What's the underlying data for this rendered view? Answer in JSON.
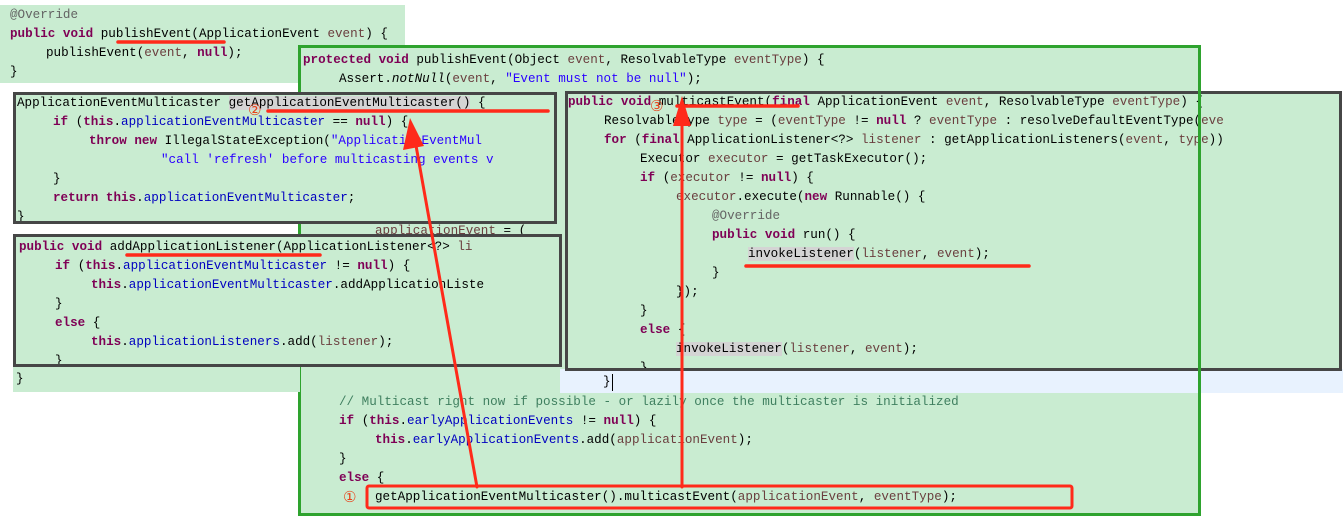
{
  "colors": {
    "panel_bg": "#c9ecd1",
    "keyword": "#7f0055",
    "field": "#0000c0",
    "string": "#2a00ff",
    "comment": "#3f7f5f",
    "annotation_mark": "#ff2a1a",
    "green_frame": "#2ea32e",
    "dark_frame": "#464646"
  },
  "panelA": {
    "lines": [
      [
        [
          "a",
          "@Override"
        ]
      ],
      [
        [
          "k",
          "public void "
        ],
        [
          "p",
          "publishEvent(ApplicationEvent "
        ],
        [
          "v",
          "event"
        ],
        [
          "p",
          ") {"
        ]
      ],
      [
        [
          "p",
          "\tpublishEvent("
        ],
        [
          "v",
          "event"
        ],
        [
          "p",
          ", "
        ],
        [
          "k",
          "null"
        ],
        [
          "p",
          ");"
        ]
      ],
      [
        [
          "p",
          "}"
        ]
      ]
    ]
  },
  "green": {
    "lines": [
      [
        [
          "k",
          "protected void "
        ],
        [
          "p",
          "publishEvent(Object "
        ],
        [
          "v",
          "event"
        ],
        [
          "p",
          ", ResolvableType "
        ],
        [
          "v",
          "eventType"
        ],
        [
          "p",
          ") {"
        ]
      ],
      [
        [
          "p",
          "\tAssert."
        ],
        [
          "i",
          "notNull"
        ],
        [
          "p",
          "("
        ],
        [
          "v",
          "event"
        ],
        [
          "p",
          ", "
        ],
        [
          "s",
          "\"Event must not be null\""
        ],
        [
          "p",
          ");"
        ]
      ],
      [],
      [],
      [],
      [],
      [],
      [],
      [],
      [
        [
          "p",
          "\t\t"
        ],
        [
          "v",
          "applicationEvent"
        ],
        [
          "p",
          " = ("
        ]
      ],
      [],
      [],
      [],
      [],
      [],
      [],
      [],
      [],
      [
        [
          "m",
          "\t// Multicast right now if possible - or lazily once the multicaster is initialized"
        ]
      ],
      [
        [
          "k",
          "\tif "
        ],
        [
          "p",
          "("
        ],
        [
          "k",
          "this"
        ],
        [
          "p",
          "."
        ],
        [
          "f",
          "earlyApplicationEvents"
        ],
        [
          "p",
          " != "
        ],
        [
          "k",
          "null"
        ],
        [
          "p",
          ") {"
        ]
      ],
      [
        [
          "k",
          "\t\tthis"
        ],
        [
          "p",
          "."
        ],
        [
          "f",
          "earlyApplicationEvents"
        ],
        [
          "p",
          ".add("
        ],
        [
          "v",
          "applicationEvent"
        ],
        [
          "p",
          ");"
        ]
      ],
      [
        [
          "p",
          "\t}"
        ]
      ],
      [
        [
          "k",
          "\telse "
        ],
        [
          "p",
          "{"
        ]
      ],
      [
        [
          "p",
          "\t\tgetApplicationEventMulticaster().multicastEvent("
        ],
        [
          "v",
          "applicationEvent"
        ],
        [
          "p",
          ", "
        ],
        [
          "v",
          "eventType"
        ],
        [
          "p",
          ");"
        ]
      ]
    ]
  },
  "panelB": {
    "lines": [
      [
        [
          "p",
          "ApplicationEventMulticaster "
        ],
        [
          "h",
          "getApplicationEventMulticaster()"
        ],
        [
          "p",
          " {"
        ]
      ],
      [
        [
          "k",
          "\tif "
        ],
        [
          "p",
          "("
        ],
        [
          "k",
          "this"
        ],
        [
          "p",
          "."
        ],
        [
          "f",
          "applicationEventMulticaster"
        ],
        [
          "p",
          " == "
        ],
        [
          "k",
          "null"
        ],
        [
          "p",
          ") {"
        ]
      ],
      [
        [
          "k",
          "\t\tthrow new "
        ],
        [
          "p",
          "IllegalStateException("
        ],
        [
          "s",
          "\"ApplicationEventMul"
        ]
      ],
      [
        [
          "s",
          "\t\t\t\t\"call 'refresh' before multicasting events v"
        ]
      ],
      [
        [
          "p",
          "\t}"
        ]
      ],
      [
        [
          "k",
          "\treturn this"
        ],
        [
          "p",
          "."
        ],
        [
          "f",
          "applicationEventMulticaster"
        ],
        [
          "p",
          ";"
        ]
      ],
      [
        [
          "p",
          "}"
        ]
      ]
    ]
  },
  "panelC": {
    "lines": [
      [
        [
          "k",
          "public void "
        ],
        [
          "p",
          "addApplicationListener(ApplicationListener<?> "
        ],
        [
          "v",
          "li"
        ]
      ],
      [
        [
          "k",
          "\tif "
        ],
        [
          "p",
          "("
        ],
        [
          "k",
          "this"
        ],
        [
          "p",
          "."
        ],
        [
          "f",
          "applicationEventMulticaster"
        ],
        [
          "p",
          " != "
        ],
        [
          "k",
          "null"
        ],
        [
          "p",
          ") {"
        ]
      ],
      [
        [
          "k",
          "\t\tthis"
        ],
        [
          "p",
          "."
        ],
        [
          "f",
          "applicationEventMulticaster"
        ],
        [
          "p",
          ".addApplicationListe"
        ]
      ],
      [
        [
          "p",
          "\t}"
        ]
      ],
      [
        [
          "k",
          "\telse "
        ],
        [
          "p",
          "{"
        ]
      ],
      [
        [
          "k",
          "\t\tthis"
        ],
        [
          "p",
          "."
        ],
        [
          "f",
          "applicationListeners"
        ],
        [
          "p",
          ".add("
        ],
        [
          "v",
          "listener"
        ],
        [
          "p",
          ");"
        ]
      ],
      [
        [
          "p",
          "\t}"
        ]
      ]
    ],
    "closing": "}"
  },
  "panelD": {
    "lines": [
      [
        [
          "k",
          "public void "
        ],
        [
          "p",
          "multicastEvent("
        ],
        [
          "k",
          "final "
        ],
        [
          "p",
          "ApplicationEvent "
        ],
        [
          "v",
          "event"
        ],
        [
          "p",
          ", ResolvableType "
        ],
        [
          "v",
          "eventType"
        ],
        [
          "p",
          ") {"
        ]
      ],
      [
        [
          "p",
          "\tResolvableType "
        ],
        [
          "v",
          "type"
        ],
        [
          "p",
          " = ("
        ],
        [
          "v",
          "eventType"
        ],
        [
          "p",
          " != "
        ],
        [
          "k",
          "null"
        ],
        [
          "p",
          " ? "
        ],
        [
          "v",
          "eventType"
        ],
        [
          "p",
          " : resolveDefaultEventType("
        ],
        [
          "v",
          "eve"
        ]
      ],
      [
        [
          "k",
          "\tfor "
        ],
        [
          "p",
          "("
        ],
        [
          "k",
          "final "
        ],
        [
          "p",
          "ApplicationListener<?> "
        ],
        [
          "v",
          "listener"
        ],
        [
          "p",
          " : getApplicationListeners("
        ],
        [
          "v",
          "event"
        ],
        [
          "p",
          ", "
        ],
        [
          "v",
          "type"
        ],
        [
          "p",
          "))"
        ]
      ],
      [
        [
          "p",
          "\t\tExecutor "
        ],
        [
          "v",
          "executor"
        ],
        [
          "p",
          " = getTaskExecutor();"
        ]
      ],
      [
        [
          "k",
          "\t\tif "
        ],
        [
          "p",
          "("
        ],
        [
          "v",
          "executor"
        ],
        [
          "p",
          " != "
        ],
        [
          "k",
          "null"
        ],
        [
          "p",
          ") {"
        ]
      ],
      [
        [
          "p",
          "\t\t\t"
        ],
        [
          "v",
          "executor"
        ],
        [
          "p",
          ".execute("
        ],
        [
          "k",
          "new "
        ],
        [
          "p",
          "Runnable() {"
        ]
      ],
      [
        [
          "a",
          "\t\t\t\t@Override"
        ]
      ],
      [
        [
          "k",
          "\t\t\t\tpublic void "
        ],
        [
          "p",
          "run() {"
        ]
      ],
      [
        [
          "p",
          "\t\t\t\t\t"
        ],
        [
          "h",
          "invokeListener"
        ],
        [
          "p",
          "("
        ],
        [
          "v",
          "listener"
        ],
        [
          "p",
          ", "
        ],
        [
          "v",
          "event"
        ],
        [
          "p",
          ");"
        ]
      ],
      [
        [
          "p",
          "\t\t\t\t}"
        ]
      ],
      [
        [
          "p",
          "\t\t\t});"
        ]
      ],
      [
        [
          "p",
          "\t\t}"
        ]
      ],
      [
        [
          "k",
          "\t\telse "
        ],
        [
          "p",
          "{"
        ]
      ],
      [
        [
          "p",
          "\t\t\t"
        ],
        [
          "h",
          "invokeListener"
        ],
        [
          "p",
          "("
        ],
        [
          "v",
          "listener"
        ],
        [
          "p",
          ", "
        ],
        [
          "v",
          "event"
        ],
        [
          "p",
          ");"
        ]
      ],
      [
        [
          "p",
          "\t\t}"
        ]
      ]
    ],
    "closing": "}"
  },
  "annotations": {
    "step1": "①",
    "step2": "②",
    "step3": "③"
  }
}
